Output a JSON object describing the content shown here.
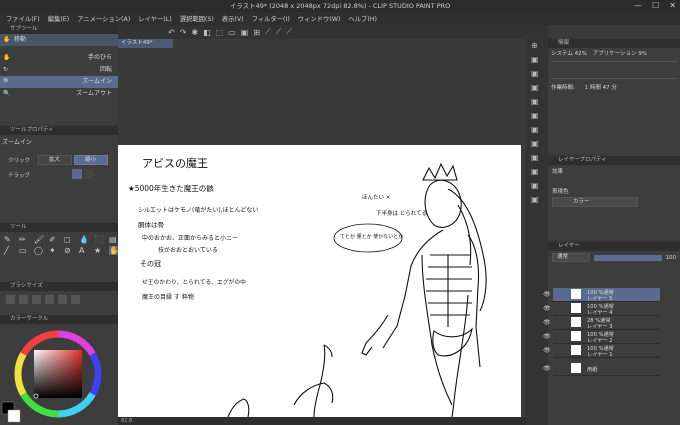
{
  "window": {
    "title": "イラスト49* (2048 x 2048px 72dpi 82.8%) - CLIP STUDIO PAINT PRO",
    "min": "—",
    "max": "☐",
    "close": "✕"
  },
  "menu": [
    "ファイル(F)",
    "編集(E)",
    "アニメーション(A)",
    "レイヤー(L)",
    "選択範囲(S)",
    "表示(V)",
    "フィルター(I)",
    "ウィンドウ(W)",
    "ヘルプ(H)"
  ],
  "document_tab": "イラスト49*",
  "subtool_panel": {
    "header": "サブツール",
    "selected_group": "移動",
    "items": [
      {
        "label": "手のひら",
        "selected": false
      },
      {
        "label": "回転",
        "selected": false
      },
      {
        "label": "ズームイン",
        "selected": true
      },
      {
        "label": "ズームアウト",
        "selected": false
      }
    ]
  },
  "tool_property": {
    "header": "ツールプロパティ",
    "title": "ズームイン",
    "click_label": "クリック",
    "click_options": [
      "拡大",
      "縮小"
    ],
    "drag_label": "ドラッグ"
  },
  "tool_panel_header": "ツール",
  "brush_panel_header": "ブラシサイズ",
  "color_panel_header": "カラーサークル",
  "navigator": {
    "header": "情報",
    "system": "システム 42%",
    "app": "アプリケーション 9%",
    "work_time_label": "作業時間:",
    "work_time": "1 時間 47 分"
  },
  "layer_property": {
    "header": "レイヤープロパティ",
    "effect_label": "効果",
    "display_color_label": "表現色",
    "display_color": "カラー"
  },
  "layers_panel": {
    "header": "レイヤー",
    "blend_mode": "通常",
    "opacity": "100",
    "layers": [
      {
        "pct": "100 %通常",
        "name": "レイヤー 5",
        "selected": true
      },
      {
        "pct": "100 %通常",
        "name": "レイヤー 4",
        "selected": false
      },
      {
        "pct": "28 %通常",
        "name": "レイヤー 3",
        "selected": false
      },
      {
        "pct": "100 %通常",
        "name": "レイヤー 2",
        "selected": false
      },
      {
        "pct": "100 %通常",
        "name": "レイヤー 1",
        "selected": false
      },
      {
        "pct": "",
        "name": "用紙",
        "selected": false
      }
    ]
  },
  "status": {
    "zoom": "82.8"
  },
  "sketch_text": {
    "title": "アビスの魔王",
    "line1": "★5000年生きた魔王の骸",
    "line2": "シルエットはケモノ(竜がたい),ほとんどない",
    "line3": "胴体は骨",
    "line4": "中のおかお、正面からみると小ニー",
    "line5": "技がおおとおいている",
    "line6": "その冠",
    "line7": "せ王のかわり、とられてる、エグがの中",
    "line8": "魔王の目縁 す 粋物",
    "note1": "ほんたい ✕",
    "note2": "下半身は とられてる",
    "note3": "てとか 量とか 使かないとか"
  }
}
